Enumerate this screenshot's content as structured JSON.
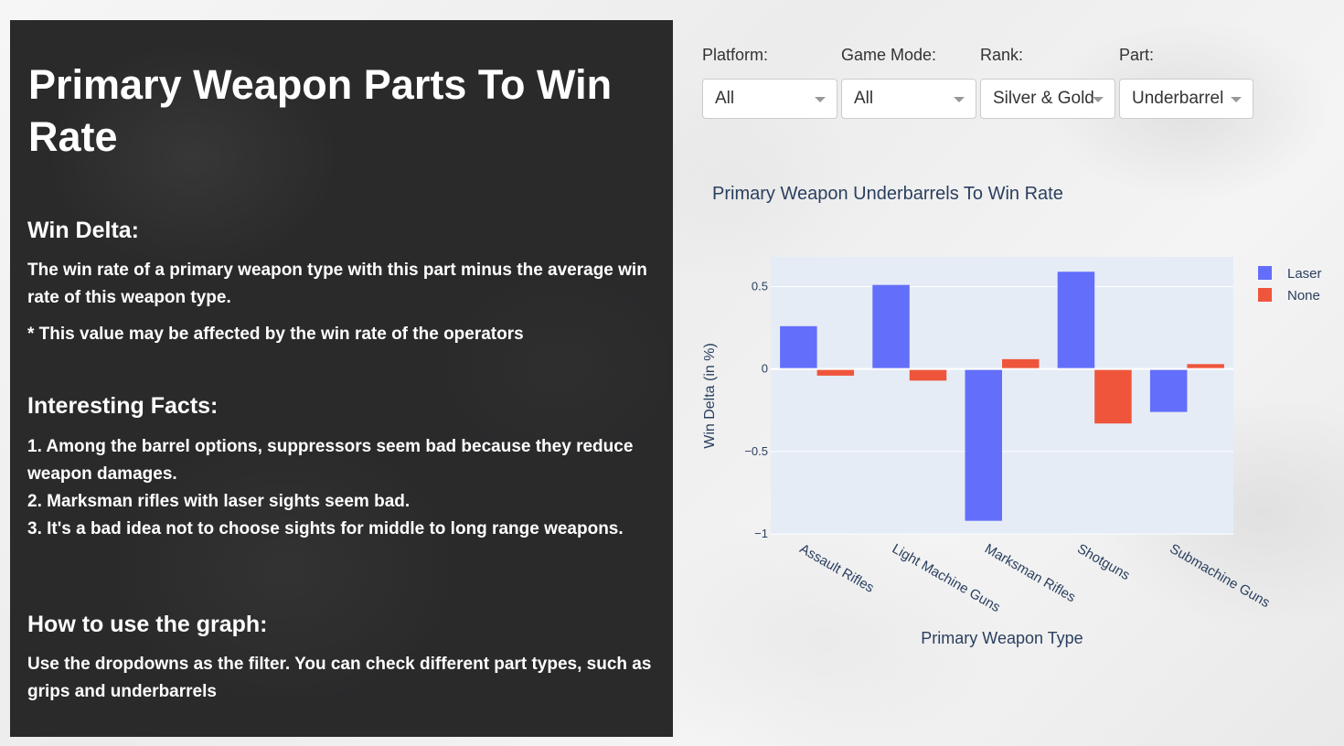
{
  "panel": {
    "title": "Primary Weapon Parts To Win Rate",
    "win_delta_heading": "Win Delta:",
    "win_delta_text": "The win rate of a primary weapon type with this part minus the average win rate of this weapon type.",
    "win_delta_note": "* This value may be affected by the win rate of the operators",
    "facts_heading": "Interesting Facts:",
    "facts": [
      "1. Among the barrel options, suppressors seem bad because they reduce weapon damages.",
      "2. Marksman rifles with laser sights seem bad.",
      "3. It's a bad idea not to choose sights for middle to long range weapons."
    ],
    "howto_heading": "How to use the graph:",
    "howto_text": "Use the dropdowns as the filter. You can check different part types, such as grips and underbarrels"
  },
  "filters": {
    "platform": {
      "label": "Platform:",
      "value": "All"
    },
    "game_mode": {
      "label": "Game Mode:",
      "value": "All"
    },
    "rank": {
      "label": "Rank:",
      "value": "Silver & Gold"
    },
    "part": {
      "label": "Part:",
      "value": "Underbarrel"
    }
  },
  "chart_data": {
    "type": "bar",
    "title": "Primary Weapon Underbarrels To Win Rate",
    "xlabel": "Primary Weapon Type",
    "ylabel": "Win Delta (in %)",
    "categories": [
      "Assault Rifles",
      "Light Machine Guns",
      "Marksman Rifles",
      "Shotguns",
      "Submachine Guns"
    ],
    "series": [
      {
        "name": "Laser",
        "values": [
          0.26,
          0.51,
          -0.92,
          0.59,
          -0.26
        ],
        "color": "#636efa"
      },
      {
        "name": "None",
        "values": [
          -0.04,
          -0.07,
          0.06,
          -0.33,
          0.03
        ],
        "color": "#ef553b"
      }
    ],
    "yticks": [
      0.5,
      0,
      -0.5,
      -1
    ],
    "ytick_labels": [
      "0.5",
      "0",
      "−0.5",
      "−1"
    ],
    "ylim": [
      -1.005,
      0.68
    ],
    "grid": true,
    "legend": "top-right",
    "plot_bg": "#e5ecf6"
  }
}
